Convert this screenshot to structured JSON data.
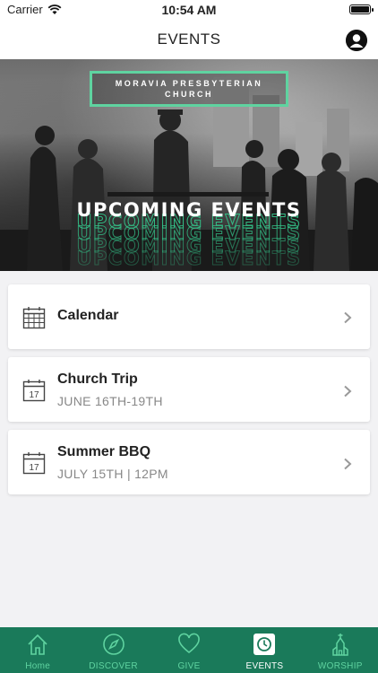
{
  "status": {
    "carrier": "Carrier",
    "time": "10:54 AM"
  },
  "nav": {
    "title": "EVENTS"
  },
  "hero": {
    "badge_line1": "MORAVIA PRESBYTERIAN",
    "badge_line2": "CHURCH",
    "headline": "UPCOMING EVENTS"
  },
  "events": [
    {
      "title": "Calendar",
      "subtitle": "",
      "icon": "calendar-grid-icon"
    },
    {
      "title": "Church Trip",
      "subtitle": "JUNE 16TH-19TH",
      "icon": "calendar-date-icon",
      "day": "17"
    },
    {
      "title": "Summer BBQ",
      "subtitle": "JULY 15TH | 12PM",
      "icon": "calendar-date-icon",
      "day": "17"
    }
  ],
  "tabs": [
    {
      "label": "Home",
      "icon": "home-icon",
      "active": false
    },
    {
      "label": "DISCOVER",
      "icon": "compass-icon",
      "active": false
    },
    {
      "label": "GIVE",
      "icon": "heart-icon",
      "active": false
    },
    {
      "label": "EVENTS",
      "icon": "clock-icon",
      "active": true
    },
    {
      "label": "WORSHIP",
      "icon": "church-icon",
      "active": false
    }
  ],
  "colors": {
    "accent": "#1a7a5a",
    "accent_light": "#5fd3a0"
  }
}
